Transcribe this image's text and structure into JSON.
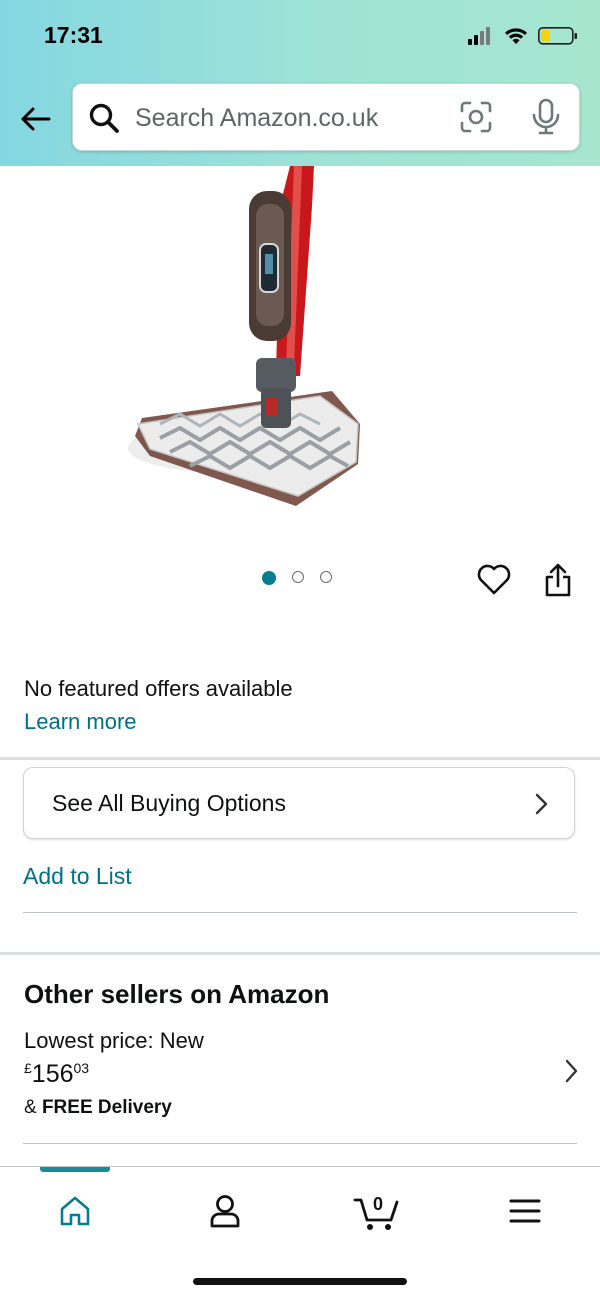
{
  "status_bar": {
    "time": "17:31"
  },
  "search": {
    "placeholder": "Search Amazon.co.uk"
  },
  "product": {
    "image_count": 3,
    "active_image_index": 1
  },
  "offers": {
    "no_offers_text": "No featured offers available",
    "learn_more": "Learn more",
    "buying_options": "See All Buying Options",
    "add_to_list": "Add to List"
  },
  "other_sellers": {
    "title": "Other sellers on Amazon",
    "lowest_price_label": "Lowest price: New",
    "price_symbol": "£",
    "price_whole": "156",
    "price_fraction": "03",
    "delivery_prefix": "& ",
    "delivery_bold": "FREE Delivery"
  },
  "bottom_nav": {
    "active": "home",
    "items": [
      "home-icon",
      "account-icon",
      "cart-icon",
      "menu-icon"
    ],
    "cart_count": "0"
  },
  "colors": {
    "link": "#007185",
    "accent": "#067d8e",
    "header_gradient_start": "#84d7e1",
    "header_gradient_end": "#a6e6cf"
  }
}
